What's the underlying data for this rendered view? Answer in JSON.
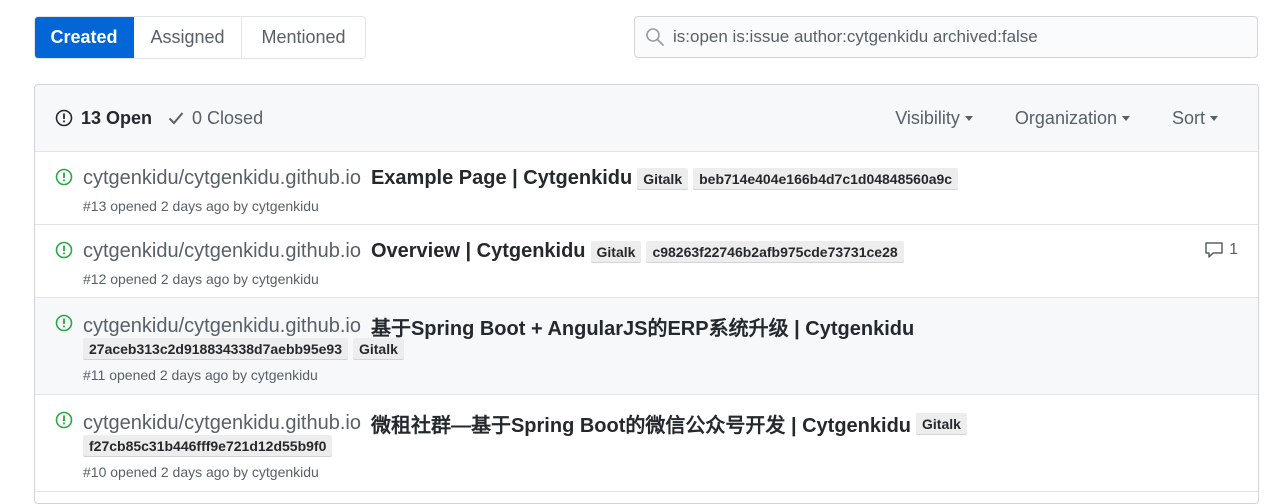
{
  "tabs": [
    {
      "label": "Created"
    },
    {
      "label": "Assigned"
    },
    {
      "label": "Mentioned"
    }
  ],
  "search": {
    "value": "is:open is:issue author:cytgenkidu archived:false"
  },
  "header": {
    "open_label": "13 Open",
    "closed_label": "0 Closed",
    "visibility": "Visibility",
    "organization": "Organization",
    "sort": "Sort"
  },
  "issues": [
    {
      "repo": "cytgenkidu/cytgenkidu.github.io",
      "title": "Example Page | Cytgenkidu",
      "labels": [
        "Gitalk",
        "beb714e404e166b4d7c1d04848560a9c"
      ],
      "meta": "#13 opened 2 days ago by cytgenkidu"
    },
    {
      "repo": "cytgenkidu/cytgenkidu.github.io",
      "title": "Overview | Cytgenkidu",
      "labels": [
        "Gitalk",
        "c98263f22746b2afb975cde73731ce28"
      ],
      "meta": "#12 opened 2 days ago by cytgenkidu",
      "comments": "1"
    },
    {
      "repo": "cytgenkidu/cytgenkidu.github.io",
      "title": "基于Spring Boot + AngularJS的ERP系统升级 | Cytgenkidu",
      "labels": [
        "27aceb313c2d918834338d7aebb95e93",
        "Gitalk"
      ],
      "meta": "#11 opened 2 days ago by cytgenkidu"
    },
    {
      "repo": "cytgenkidu/cytgenkidu.github.io",
      "title": "微租社群—基于Spring Boot的微信公众号开发 | Cytgenkidu",
      "labels": [
        "Gitalk",
        "f27cb85c31b446fff9e721d12d55b9f0"
      ],
      "meta": "#10 opened 2 days ago by cytgenkidu"
    }
  ]
}
